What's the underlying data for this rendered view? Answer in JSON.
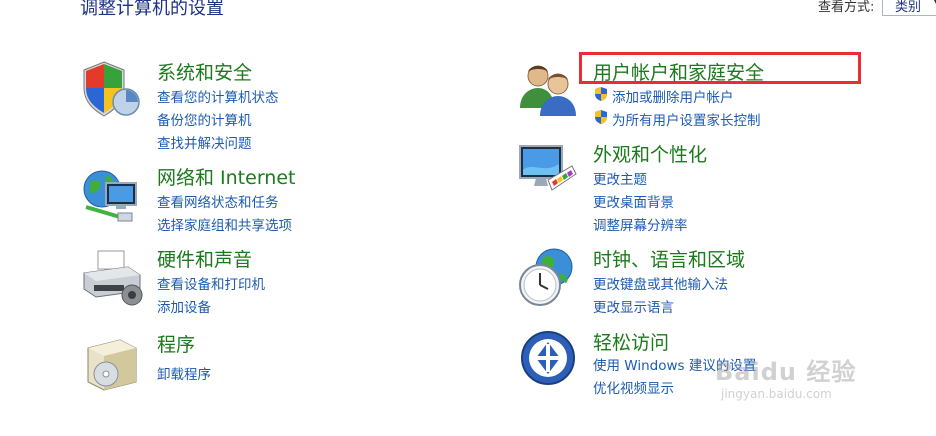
{
  "header": {
    "title": "调整计算机的设置",
    "view_label": "查看方式:",
    "view_value": "类别"
  },
  "categories": [
    {
      "title": "系统和安全",
      "links": [
        "查看您的计算机状态",
        "备份您的计算机",
        "查找并解决问题"
      ]
    },
    {
      "title": "网络和 Internet",
      "links": [
        "查看网络状态和任务",
        "选择家庭组和共享选项"
      ]
    },
    {
      "title": "硬件和声音",
      "links": [
        "查看设备和打印机",
        "添加设备"
      ]
    },
    {
      "title": "程序",
      "links": [
        "卸载程序"
      ]
    },
    {
      "title": "用户帐户和家庭安全",
      "links": [
        "添加或删除用户帐户",
        "为所有用户设置家长控制"
      ]
    },
    {
      "title": "外观和个性化",
      "links": [
        "更改主题",
        "更改桌面背景",
        "调整屏幕分辨率"
      ]
    },
    {
      "title": "时钟、语言和区域",
      "links": [
        "更改键盘或其他输入法",
        "更改显示语言"
      ]
    },
    {
      "title": "轻松访问",
      "links": [
        "使用 Windows 建议的设置",
        "优化视频显示"
      ]
    }
  ],
  "watermark": {
    "brand": "Baidu 经验",
    "url": "jingyan.baidu.com"
  },
  "colors": {
    "category_title": "#1b7a1b",
    "link": "#1e5bb0",
    "highlight": "#ea2d35"
  }
}
